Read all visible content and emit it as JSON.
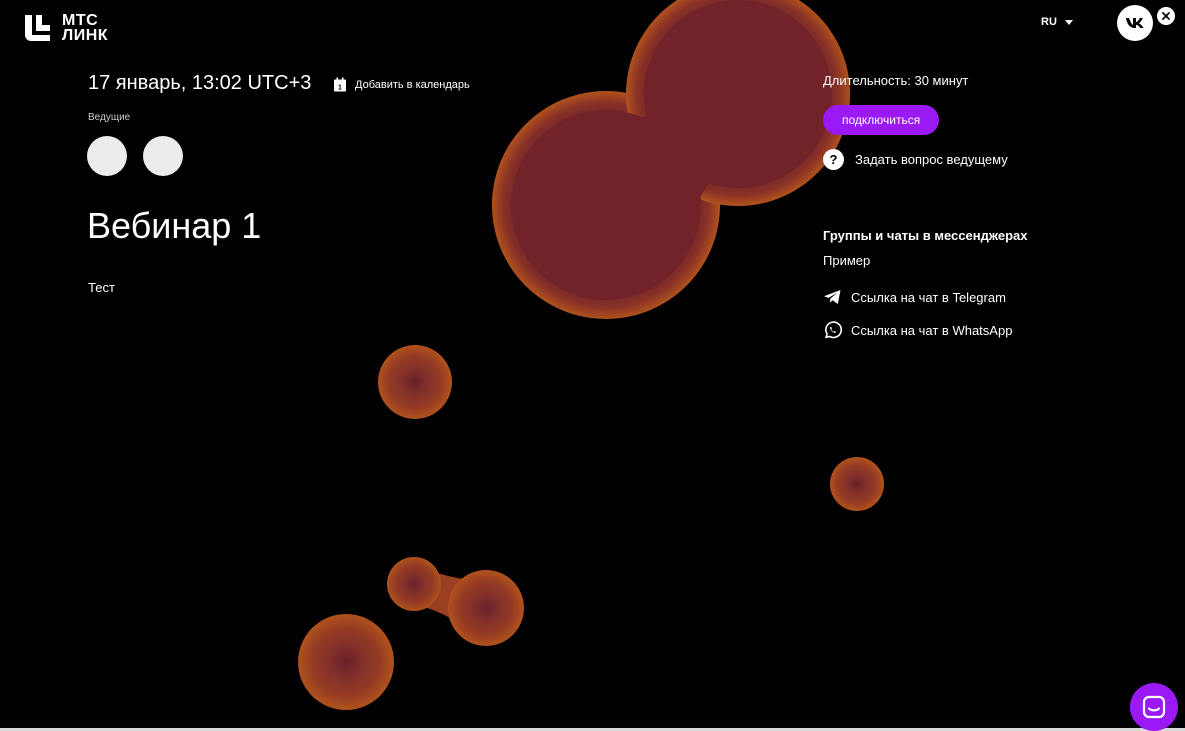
{
  "logo": {
    "line1": "МТС",
    "line2": "ЛИНК"
  },
  "header": {
    "language": "RU"
  },
  "event": {
    "date": "17 январь, 13:02 UTC+3",
    "add_to_calendar": "Добавить в календарь",
    "calendar_day": "1",
    "hosts_label": "Ведущие",
    "title": "Вебинар 1",
    "description": "Тест"
  },
  "sidebar": {
    "duration": "Длительность: 30 минут",
    "connect_label": "подключиться",
    "ask_icon": "?",
    "ask_label": "Задать вопрос ведущему",
    "groups_title": "Группы и чаты в мессенджерах",
    "groups_example": "Пример",
    "links": [
      {
        "icon": "telegram-icon",
        "label": "Ссылка на чат в Telegram"
      },
      {
        "icon": "whatsapp-icon",
        "label": "Ссылка на чат в WhatsApp"
      }
    ]
  },
  "colors": {
    "accent": "#9b19f5",
    "blob_core": "#72232a",
    "blob_edge": "#b0521c"
  }
}
